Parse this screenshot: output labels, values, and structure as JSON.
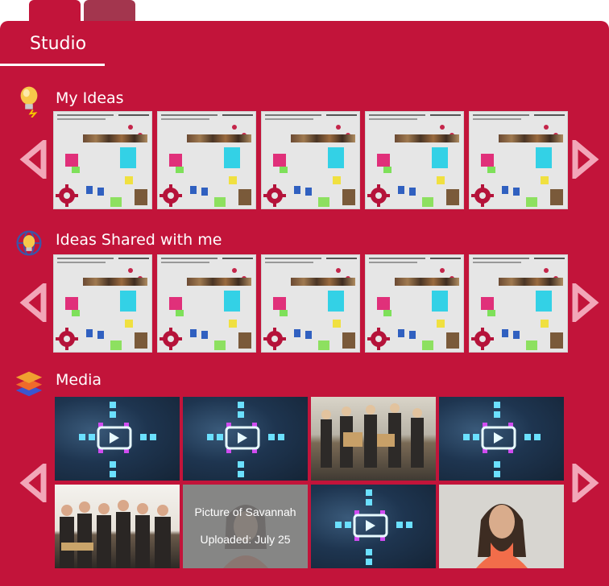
{
  "tabs": [
    "",
    ""
  ],
  "studio": {
    "title": "Studio"
  },
  "sections": {
    "my_ideas": {
      "title": "My Ideas"
    },
    "shared": {
      "title": "Ideas Shared with me"
    },
    "media": {
      "title": "Media"
    }
  },
  "media_caption": {
    "title": "Picture of Savannah",
    "uploaded": "Uploaded: July 25"
  },
  "colors": {
    "panel": "#c2143a",
    "arrow": "#f2a6b8",
    "tab_inactive": "#a3364e"
  },
  "icons": [
    "lightbulb-icon",
    "globe-lightbulb-icon",
    "stacked-layers-icon",
    "chevron-left-icon",
    "chevron-right-icon",
    "gear-icon"
  ]
}
